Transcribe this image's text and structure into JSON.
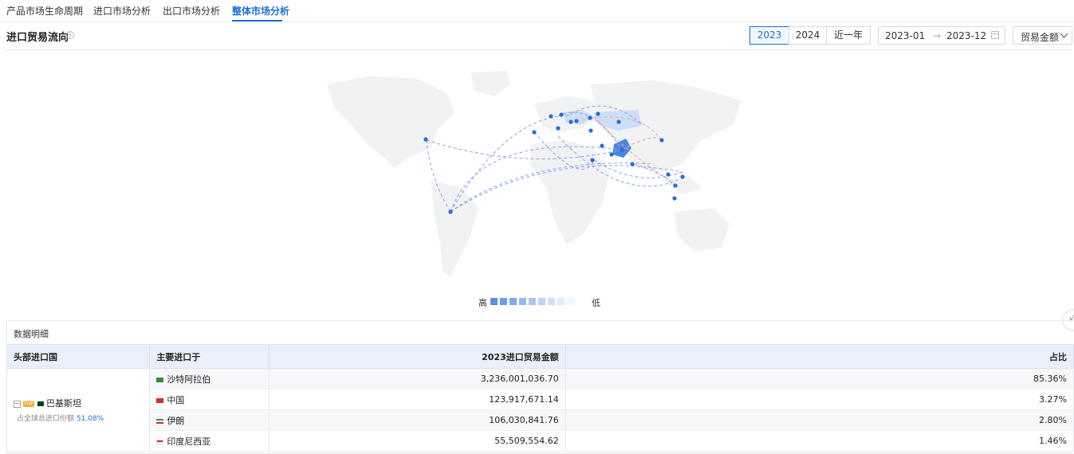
{
  "tabs": [
    {
      "label": "产品市场生命周期"
    },
    {
      "label": "进口市场分析"
    },
    {
      "label": "出口市场分析"
    },
    {
      "label": "整体市场分析"
    }
  ],
  "active_tab": "整体市场分析",
  "section": {
    "title": "进口贸易流向",
    "info_icon": "info-circle-icon"
  },
  "filters": {
    "year_buttons": [
      "2023",
      "2024",
      "近一年"
    ],
    "active_year": "2023",
    "date_start": "2023-01",
    "date_separator": "→",
    "date_end": "2023-12",
    "calendar_icon": "calendar-icon",
    "metric_select": "贸易金额",
    "chevron_icon": "chevron-down-icon"
  },
  "map": {
    "land_color": "#f1f2f4",
    "highlight_color": "#4a86e0",
    "flow_colors": [
      "#8f9fe6",
      "#e8a3a3"
    ],
    "node_color": "#2a6bd6"
  },
  "legend": {
    "high_label": "高",
    "low_label": "低",
    "colors": [
      "#5b8fe6",
      "#6f9ce9",
      "#82a9ec",
      "#96b7ef",
      "#a9c4f2",
      "#bdd2f5",
      "#d0dff8",
      "#e4ecfb",
      "#f0f4fc"
    ]
  },
  "side_tab_text": "√",
  "detail": {
    "title": "数据明细",
    "columns": [
      "头部进口国",
      "主要进口于",
      "2023进口贸易金额",
      "占比"
    ],
    "country": {
      "expand_symbol": "−",
      "badge": "TOP",
      "name": "巴基斯坦",
      "share_label": "占全球总进口份额",
      "share_value": "51.08%"
    },
    "rows": [
      {
        "partner": "沙特阿拉伯",
        "amount": "3,236,001,036.70",
        "share": "85.36%",
        "flag": "#2f8f3a"
      },
      {
        "partner": "中国",
        "amount": "123,917,671.14",
        "share": "3.27%",
        "flag": "#e0252b"
      },
      {
        "partner": "伊朗",
        "amount": "106,030,841.76",
        "share": "2.80%",
        "flag": "#3a8f3a"
      },
      {
        "partner": "印度尼西亚",
        "amount": "55,509,554.62",
        "share": "1.46%",
        "flag": "#e0252b"
      }
    ]
  }
}
